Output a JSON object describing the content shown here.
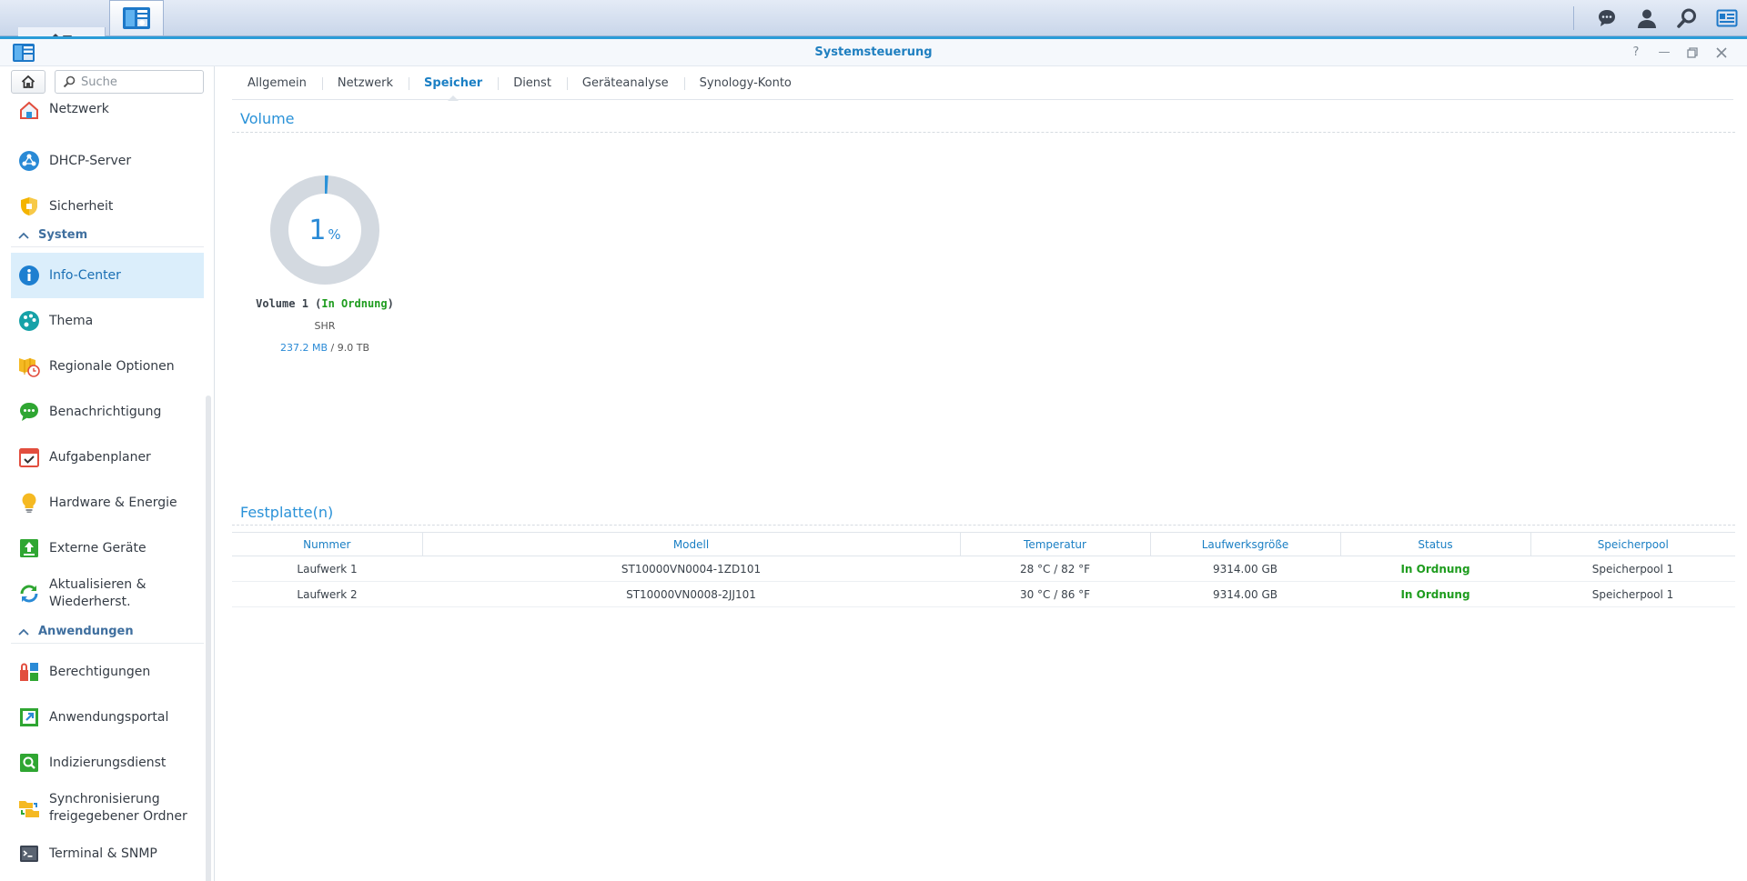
{
  "window": {
    "title": "Systemsteuerung"
  },
  "sidebar": {
    "search_placeholder": "Suche",
    "items": [
      {
        "label": "Netzwerk",
        "icon": "network-house-icon"
      },
      {
        "label": "DHCP-Server",
        "icon": "dhcp-icon"
      },
      {
        "label": "Sicherheit",
        "icon": "shield-icon"
      },
      {
        "section": "System"
      },
      {
        "label": "Info-Center",
        "icon": "info-icon",
        "active": true
      },
      {
        "label": "Thema",
        "icon": "palette-icon"
      },
      {
        "label": "Regionale Optionen",
        "icon": "map-clock-icon"
      },
      {
        "label": "Benachrichtigung",
        "icon": "speech-bubble-icon"
      },
      {
        "label": "Aufgabenplaner",
        "icon": "calendar-icon"
      },
      {
        "label": "Hardware & Energie",
        "icon": "lightbulb-icon"
      },
      {
        "label": "Externe Geräte",
        "icon": "upload-icon"
      },
      {
        "label": "Aktualisieren & Wiederherst.",
        "icon": "refresh-icon"
      },
      {
        "section": "Anwendungen"
      },
      {
        "label": "Berechtigungen",
        "icon": "permissions-icon"
      },
      {
        "label": "Anwendungsportal",
        "icon": "portal-icon"
      },
      {
        "label": "Indizierungsdienst",
        "icon": "index-search-icon"
      },
      {
        "label": "Synchronisierung freigegebener Ordner",
        "icon": "folder-sync-icon"
      },
      {
        "label": "Terminal & SNMP",
        "icon": "terminal-icon"
      }
    ]
  },
  "tabs": [
    {
      "label": "Allgemein"
    },
    {
      "label": "Netzwerk"
    },
    {
      "label": "Speicher",
      "active": true
    },
    {
      "label": "Dienst"
    },
    {
      "label": "Geräteanalyse"
    },
    {
      "label": "Synology-Konto"
    }
  ],
  "volume": {
    "section_title": "Volume",
    "percent": "1",
    "percent_sign": "%",
    "usage_fraction": 0.01,
    "name": "Volume 1",
    "status": "In Ordnung",
    "type": "SHR",
    "used": "237.2 MB",
    "total": "9.0 TB"
  },
  "disks": {
    "section_title": "Festplatte(n)",
    "columns": [
      "Nummer",
      "Modell",
      "Temperatur",
      "Laufwerksgröße",
      "Status",
      "Speicherpool"
    ],
    "rows": [
      [
        "Laufwerk 1",
        "ST10000VN0004-1ZD101",
        "28 °C / 82 °F",
        "9314.00 GB",
        "In Ordnung",
        "Speicherpool 1"
      ],
      [
        "Laufwerk 2",
        "ST10000VN0008-2JJ101",
        "30 °C / 86 °F",
        "9314.00 GB",
        "In Ordnung",
        "Speicherpool 1"
      ]
    ]
  },
  "colors": {
    "accent": "#2a92d8",
    "ok": "#1e9c1e",
    "donut_track": "#d3d9e0"
  }
}
